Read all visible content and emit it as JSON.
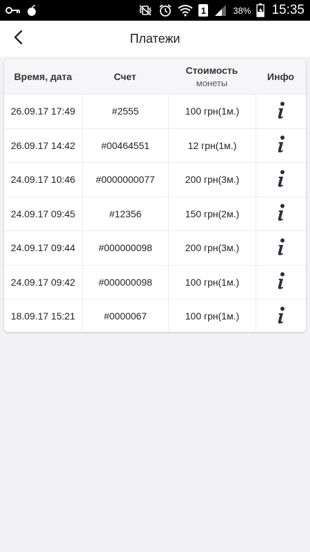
{
  "status_bar": {
    "battery_percent": "38%",
    "time": "15:35",
    "sim_slot": "1",
    "icons": [
      "key-icon",
      "bomb-icon",
      "mute-vibrate-icon",
      "alarm-icon",
      "wifi-icon",
      "sim-icon",
      "signal-icon",
      "battery-charging-icon"
    ]
  },
  "header": {
    "back_icon": "chevron-left-icon",
    "title": "Платежи"
  },
  "table": {
    "columns": [
      {
        "label": "Время, дата",
        "sub": ""
      },
      {
        "label": "Счет",
        "sub": ""
      },
      {
        "label": "Стоимость",
        "sub": "монеты"
      },
      {
        "label": "Инфо",
        "sub": ""
      }
    ],
    "rows": [
      {
        "datetime": "26.09.17 17:49",
        "account": "#2555",
        "cost": "100 грн(1м.)",
        "info": "i"
      },
      {
        "datetime": "26.09.17 14:42",
        "account": "#00464551",
        "cost": "12 грн(1м.)",
        "info": "i"
      },
      {
        "datetime": "24.09.17 10:46",
        "account": "#0000000077",
        "cost": "200 грн(3м.)",
        "info": "i"
      },
      {
        "datetime": "24.09.17 09:45",
        "account": "#12356",
        "cost": "150 грн(2м.)",
        "info": "i"
      },
      {
        "datetime": "24.09.17 09:44",
        "account": "#000000098",
        "cost": "200 грн(3м.)",
        "info": "i"
      },
      {
        "datetime": "24.09.17 09:42",
        "account": "#000000098",
        "cost": "100 грн(1м.)",
        "info": "i"
      },
      {
        "datetime": "18.09.17 15:21",
        "account": "#0000067",
        "cost": "100 грн(1м.)",
        "info": "i"
      }
    ]
  },
  "colors": {
    "background": "#f2f2f4",
    "header_row": "#f6f6f8",
    "text": "#222222",
    "status_bar": "#000000"
  }
}
